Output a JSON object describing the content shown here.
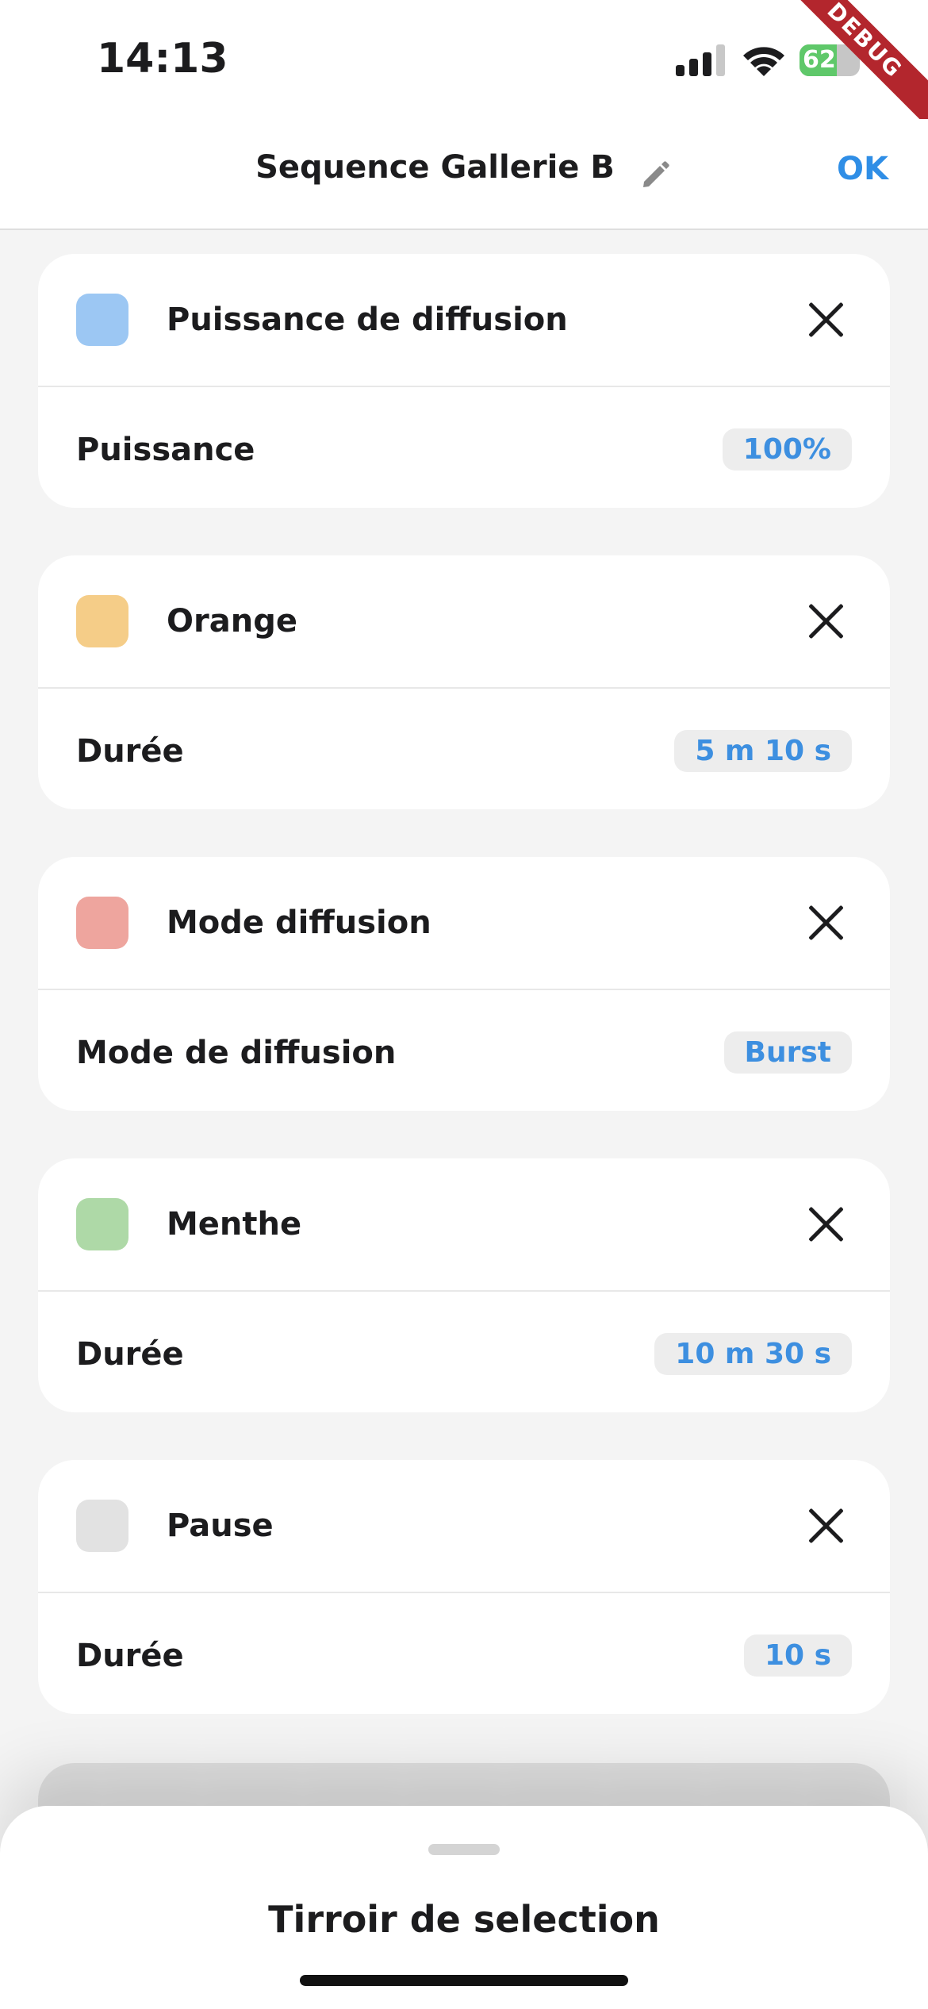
{
  "status_bar": {
    "time": "14:13",
    "battery_percent": "62",
    "debug_banner": "DEBUG",
    "icons": [
      "cellular-signal-icon",
      "wifi-icon",
      "battery-charging-icon"
    ]
  },
  "header": {
    "title": "Sequence Gallerie B",
    "edit_icon": "pencil-icon",
    "ok_label": "OK"
  },
  "cards": [
    {
      "title": "Puissance de diffusion",
      "color": "#9cc7f3",
      "param_label": "Puissance",
      "param_value": "100%"
    },
    {
      "title": "Orange",
      "color": "#f5cd88",
      "param_label": "Durée",
      "param_value": "5 m 10 s"
    },
    {
      "title": "Mode diffusion",
      "color": "#eea59e",
      "param_label": "Mode de diffusion",
      "param_value": "Burst"
    },
    {
      "title": "Menthe",
      "color": "#aed9a7",
      "param_label": "Durée",
      "param_value": "10 m 30 s"
    },
    {
      "title": "Pause",
      "color": "#e2e2e2",
      "param_label": "Durée",
      "param_value": "10 s"
    }
  ],
  "accent_color": "#2f8ee6",
  "bottom_sheet": {
    "title": "Tirroir de selection"
  }
}
